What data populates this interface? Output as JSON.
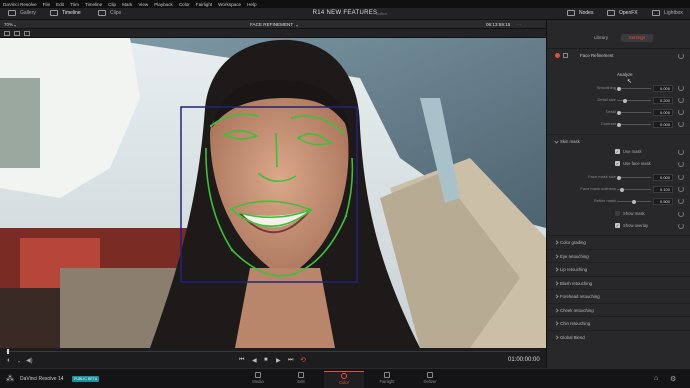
{
  "menu": [
    "DaVinci Resolve",
    "File",
    "Edit",
    "Trim",
    "Timeline",
    "Clip",
    "Mark",
    "View",
    "Playback",
    "Color",
    "Fairlight",
    "Workspace",
    "Help"
  ],
  "topbar": {
    "gallery": "Gallery",
    "timeline": "Timeline",
    "clips": "Clips",
    "project_title": "R14 NEW FEATURES",
    "project_status": "Edited",
    "nodes": "Nodes",
    "openfx": "OpenFX",
    "lightbox": "Lightbox"
  },
  "viewer": {
    "zoom": "70%",
    "clip_name": "FACE REFINEMENT",
    "timecode": "06:13:59:15"
  },
  "panel": {
    "tabs": {
      "library": "Library",
      "settings": "Settings"
    },
    "title": "Face Refinement",
    "analyze": "Analyze",
    "sliders": [
      {
        "label": "Smoothing",
        "value": "0.000",
        "level": 0.0
      },
      {
        "label": "Detail size",
        "value": "0.200",
        "level": 0.2
      },
      {
        "label": "Detail",
        "value": "0.000",
        "level": 0.0
      },
      {
        "label": "Contrast",
        "value": "0.000",
        "level": 0.0
      }
    ],
    "skin_mask": {
      "title": "Skin mask",
      "use_mask": "Use mask",
      "use_face_mask": "Use face mask",
      "sliders": [
        {
          "label": "Face mask size",
          "value": "0.000",
          "level": 0.0
        },
        {
          "label": "Face mask softness",
          "value": "0.100",
          "level": 0.1
        },
        {
          "label": "Refine mask",
          "value": "0.500",
          "level": 0.5
        }
      ],
      "show_mask": "Show mask",
      "show_overlay": "Show overlay"
    },
    "sections": [
      "Color grading",
      "Eye retouching",
      "Lip retouching",
      "Blush retouching",
      "Forehead retouching",
      "Cheek retouching",
      "Chin retouching",
      "Global Blend"
    ]
  },
  "transport": {
    "timecode": "01:00:00:00"
  },
  "bottom": {
    "app_name": "DaVinci Resolve 14",
    "badge": "PUBLIC BETA",
    "pages": [
      "Media",
      "Edit",
      "Color",
      "Fairlight",
      "Deliver"
    ],
    "active_page": "Color"
  },
  "colors": {
    "accent": "#e64b3c",
    "tracker": "#3fbf3a",
    "bbox": "#23237a",
    "badge": "#1d8f9a"
  }
}
